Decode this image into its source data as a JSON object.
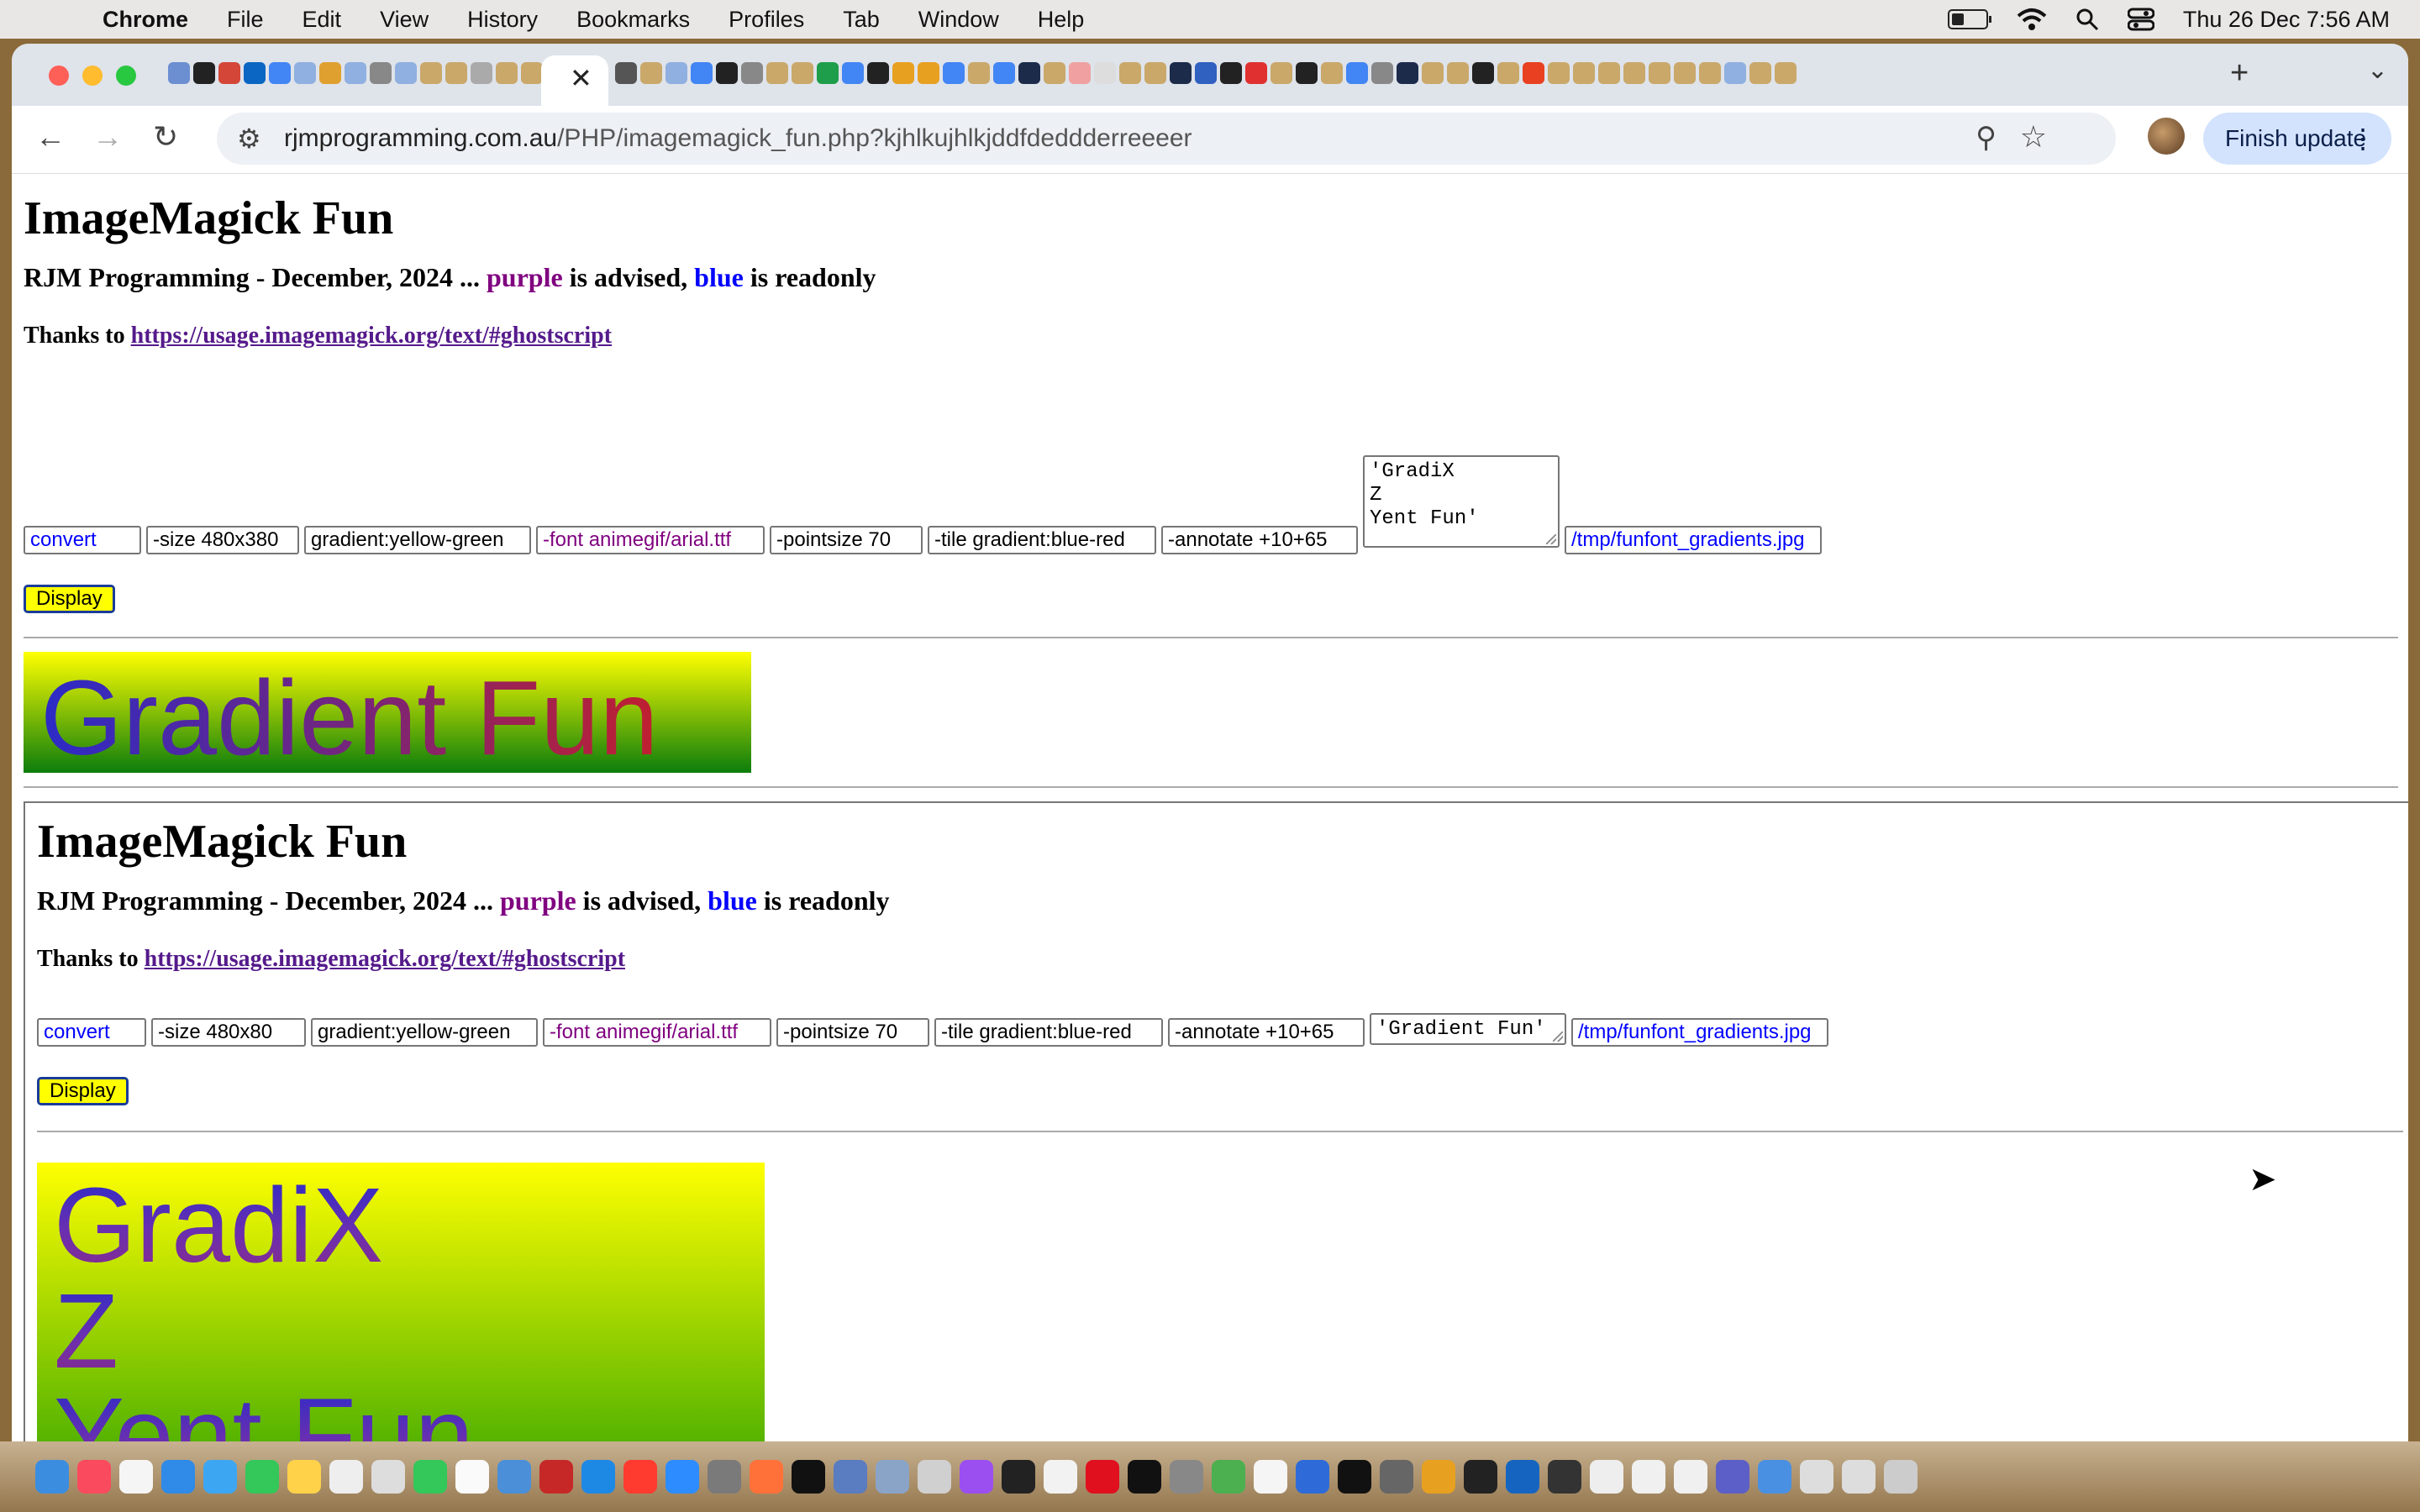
{
  "menubar": {
    "app": "Chrome",
    "items": [
      "File",
      "Edit",
      "View",
      "History",
      "Bookmarks",
      "Profiles",
      "Tab",
      "Window",
      "Help"
    ],
    "datetime": "Thu 26 Dec  7:56 AM"
  },
  "browser": {
    "active_tab_close": "✕",
    "new_tab": "+",
    "url_host": "rjmprogramming.com.au",
    "url_path": "/PHP/imagemagick_fun.php?kjhlkujhlkjddfdeddderreeeer",
    "update_button": "Finish update"
  },
  "page": {
    "title": "ImageMagick Fun",
    "subtitle_prefix": "RJM Programming - December, 2024 ... ",
    "subtitle_purple": "purple",
    "subtitle_mid": " is advised, ",
    "subtitle_blue": "blue",
    "subtitle_suffix": " is readonly",
    "thanks_prefix": "Thanks to ",
    "thanks_link": "https://usage.imagemagick.org/text/#ghostscript",
    "form": {
      "command": "convert",
      "size": "-size 480x380",
      "gradient": "gradient:yellow-green",
      "font": "-font animegif/arial.ttf",
      "pointsize": "-pointsize 70",
      "tile": "-tile gradient:blue-red",
      "annotate": "-annotate +10+65",
      "text": "'GradiX\nZ\nYent Fun'",
      "output": "/tmp/funfont_gradients.jpg",
      "display_button": "Display"
    },
    "result_image_text": "Gradient Fun"
  },
  "iframe": {
    "title": "ImageMagick Fun",
    "subtitle_prefix": "RJM Programming - December, 2024 ... ",
    "subtitle_purple": "purple",
    "subtitle_mid": " is advised, ",
    "subtitle_blue": "blue",
    "subtitle_suffix": " is readonly",
    "thanks_prefix": "Thanks to ",
    "thanks_link": "https://usage.imagemagick.org/text/#ghostscript",
    "form": {
      "command": "convert",
      "size": "-size 480x80",
      "gradient": "gradient:yellow-green",
      "font": "-font animegif/arial.ttf",
      "pointsize": "-pointsize 70",
      "tile": "-tile gradient:blue-red",
      "annotate": "-annotate +10+65",
      "text": "'Gradient Fun'",
      "output": "/tmp/funfont_gradients.jpg",
      "display_button": "Display"
    },
    "result_lines": [
      "GradiX",
      "Z",
      "Yent Fun"
    ]
  },
  "colors": {
    "readonly": "#0000ff",
    "advised": "#800080",
    "button_bg": "#ffff00"
  }
}
